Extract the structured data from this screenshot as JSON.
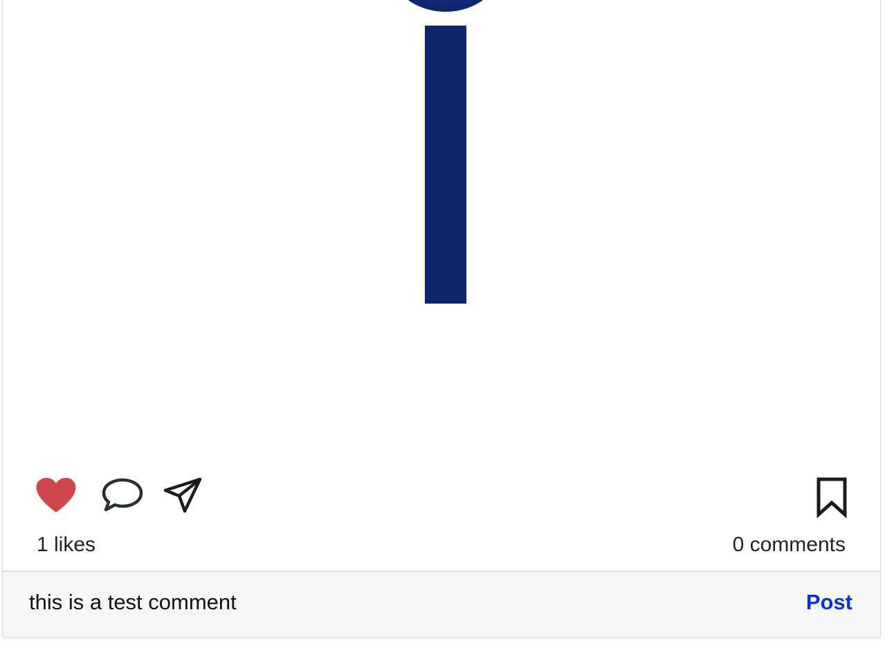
{
  "post": {
    "image_icon": "info-icon",
    "image_color": "#0e2670"
  },
  "actions": {
    "like_icon": "heart-icon",
    "like_color": "#d0454c",
    "liked": true,
    "comment_icon": "speech-bubble-icon",
    "share_icon": "paper-plane-icon",
    "save_icon": "bookmark-icon"
  },
  "stats": {
    "likes_label": "1 likes",
    "comments_label": "0 comments"
  },
  "comment_box": {
    "value": "this is a test comment",
    "post_label": "Post",
    "post_color": "#0a2fe0"
  }
}
